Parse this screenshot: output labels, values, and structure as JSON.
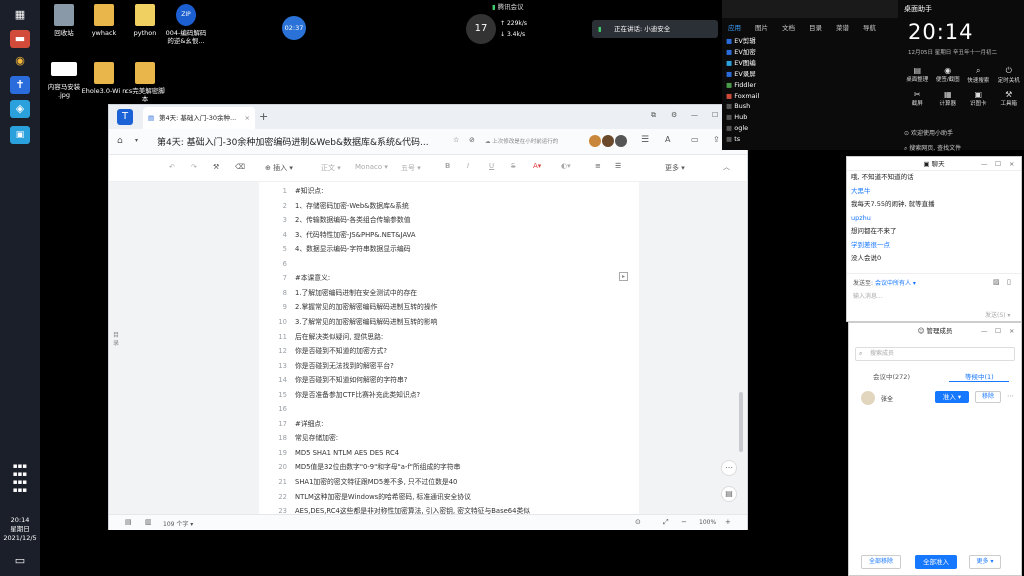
{
  "desktop": {
    "icons": [
      {
        "label": "回收站",
        "icon": "recycle-bin-icon"
      },
      {
        "label": "ywhack",
        "icon": "folder-icon"
      },
      {
        "label": "python",
        "icon": "file-icon"
      },
      {
        "label": "004-编码解码 的逆&幺恨...",
        "icon": "zip-icon"
      },
      {
        "label": "内容马安装 .jpg",
        "icon": "image-icon"
      },
      {
        "label": "Ehole3.0-Wi n",
        "icon": "folder-icon"
      },
      {
        "label": "cs完美解密脚 本",
        "icon": "folder-icon"
      }
    ],
    "speed_percent": "17",
    "up_rate": "229k/s",
    "down_rate": "3.4k/s",
    "timer": "02:37",
    "meeting_label": "腾讯会议",
    "speaking_label": "正在讲话: 小迪安全"
  },
  "taskbar": {
    "time": "20:14",
    "weekday": "星期日",
    "date": "2021/12/5"
  },
  "editor": {
    "tab_title": "第4天: 基础入门-30余种...",
    "doc_title": "第4天: 基础入门-30余种加密编码进制&Web&数据库&系统&代码...",
    "cloud_status": "上次修改是在小时前运行的",
    "format": {
      "insert": "插入",
      "style": "正文",
      "font": "Monaco",
      "size": "五号",
      "more": "更多"
    },
    "lines": [
      {
        "no": "1",
        "text": "#知识点:"
      },
      {
        "no": "2",
        "text": "1、存储密码加密-Web&数据库&系统"
      },
      {
        "no": "3",
        "text": "2、传输数据编码-各类组合传输参数值"
      },
      {
        "no": "4",
        "text": "3、代码特性加密-JS&PHP&.NET&JAVA"
      },
      {
        "no": "5",
        "text": "4、数据显示编码-字符串数据显示编码"
      },
      {
        "no": "6",
        "text": ""
      },
      {
        "no": "7",
        "text": "#本课意义:"
      },
      {
        "no": "8",
        "text": "1.了解加密编码进制在安全测试中的存在"
      },
      {
        "no": "9",
        "text": "2.掌握常见的加密解密编码解码进制互转的操作"
      },
      {
        "no": "10",
        "text": "3.了解常见的加密解密编码解码进制互转的影响"
      },
      {
        "no": "11",
        "text": "后在解决类似疑问, 提供思路:"
      },
      {
        "no": "12",
        "text": "你是否碰到不知道的加密方式?"
      },
      {
        "no": "13",
        "text": "你是否碰到无法找到的解密平台?"
      },
      {
        "no": "14",
        "text": "你是否碰到不知道如何解密的字符串?"
      },
      {
        "no": "15",
        "text": "你是否准备参加CTF比赛补充此类知识点?"
      },
      {
        "no": "16",
        "text": ""
      },
      {
        "no": "17",
        "text": "#详细点:"
      },
      {
        "no": "18",
        "text": "常见存储加密:"
      },
      {
        "no": "19",
        "text": "MD5 SHA1 NTLM AES DES RC4"
      },
      {
        "no": "20",
        "text": "MD5值是32位由数字\"0-9\"和字母\"a-f\"所组成的字符串"
      },
      {
        "no": "21",
        "text": "SHA1加密的密文特征跟MD5差不多, 只不过位数是40"
      },
      {
        "no": "22",
        "text": "NTLM这种加密是Windows的哈希密码, 标准通讯安全协议"
      },
      {
        "no": "23",
        "text": "AES,DES,RC4这些都是非对称性加密算法, 引入密钥, 密文特征与Base64类似"
      }
    ],
    "status": {
      "word_count": "109 个字",
      "zoom": "100%"
    }
  },
  "right_panel": {
    "tabs": [
      "应用",
      "图片",
      "文档",
      "目录",
      "菜谱",
      "导航"
    ],
    "apps": [
      "EV剪辑",
      "EV加密",
      "EV图编",
      "EV录屏",
      "Fiddler",
      "Foxmail",
      "Bush",
      "Hub",
      "ogle",
      "ts"
    ],
    "clock_title": "桌面助手",
    "clock_time": "20:14",
    "clock_date": "12月05日",
    "clock_weekday": "星期日",
    "clock_lunar": "辛丑年十一月初二",
    "quick_tools": [
      "桌面整理",
      "便签/截图",
      "快速搜索",
      "定时关机",
      "截屏",
      "计算器",
      "识图卡",
      "工具箱"
    ],
    "search_hint": "搜索网页, 查找文件",
    "link_label": "欢迎使用小助手"
  },
  "chat": {
    "title": "聊天",
    "messages": [
      {
        "from": "",
        "text": "哦, 不知道不知道的话"
      },
      {
        "from": "大黑牛",
        "text": "我每天7.55的闹钟, 就等直播"
      },
      {
        "from": "upzhu",
        "text": "想问都在不来了"
      },
      {
        "from": "学到差很一点",
        "text": "没人会说0"
      }
    ],
    "send_to_label": "发送至:",
    "send_to_value": "会议中所有人",
    "input_placeholder": "输入消息...",
    "send_label": "发送(S)"
  },
  "members": {
    "title": "管理成员",
    "search_placeholder": "搜索成员",
    "tab_in_meeting": "会议中(272)",
    "tab_waiting": "等候中(1)",
    "member_name": "张全",
    "admit_label": "准入",
    "remove_label": "移除",
    "remove_all": "全部移除",
    "admit_all": "全部准入",
    "more_label": "更多"
  }
}
